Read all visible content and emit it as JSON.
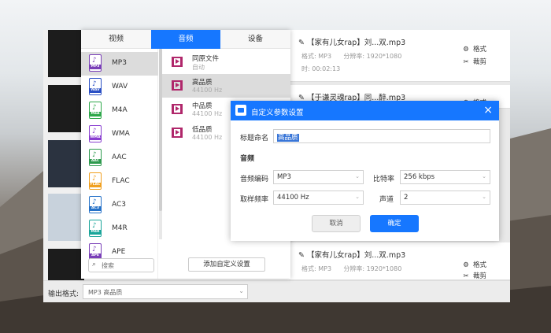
{
  "tabs": [
    {
      "label": "视频"
    },
    {
      "label": "音频"
    },
    {
      "label": "设备"
    }
  ],
  "formats": [
    {
      "label": "MP3",
      "tag": "MP3",
      "color": "#7a3fb8"
    },
    {
      "label": "WAV",
      "tag": "WAV",
      "color": "#2a4fc4"
    },
    {
      "label": "M4A",
      "tag": "M4A",
      "color": "#2ea84a"
    },
    {
      "label": "WMA",
      "tag": "WMA",
      "color": "#8a3fd0"
    },
    {
      "label": "AAC",
      "tag": "AAC",
      "color": "#2e9a4e"
    },
    {
      "label": "FLAC",
      "tag": "FLAC",
      "color": "#f0a020"
    },
    {
      "label": "AC3",
      "tag": "AC3",
      "color": "#2672c8"
    },
    {
      "label": "M4R",
      "tag": "M4R",
      "color": "#1aa59a"
    },
    {
      "label": "APE",
      "tag": "APE",
      "color": "#7a3fb8"
    }
  ],
  "search": {
    "placeholder": "搜索"
  },
  "qualities": [
    {
      "name": "同原文件",
      "sub": "自动"
    },
    {
      "name": "高品质",
      "sub": "44100 Hz"
    },
    {
      "name": "中品质",
      "sub": "44100 Hz"
    },
    {
      "name": "低品质",
      "sub": "44100 Hz"
    }
  ],
  "add_custom_label": "添加自定义设置",
  "files": [
    {
      "name": "【家有儿女rap】刘...双.mp3",
      "format": "格式: MP3",
      "resolution": "分辨率: 1920*1080",
      "duration": "时: 00:02:13",
      "act1": "格式",
      "act2": "裁剪"
    },
    {
      "name": "【于谦灵魂rap】同...醉.mp3",
      "act1": "格式"
    },
    {
      "name": "【家有儿女rap】刘...双.mp3",
      "format": "格式: MP3",
      "resolution": "分辨率: 1920*1080",
      "act1": "格式",
      "act2": "裁剪"
    }
  ],
  "output": {
    "label": "输出格式:",
    "value": "MP3  高品质"
  },
  "dialog": {
    "title": "自定义参数设置",
    "close": "×",
    "name_label": "标题命名",
    "name_value": "高品质",
    "section": "音频",
    "codec_label": "音频编码",
    "codec_value": "MP3",
    "bitrate_label": "比特率",
    "bitrate_value": "256 kbps",
    "samplerate_label": "取样频率",
    "samplerate_value": "44100 Hz",
    "channel_label": "声道",
    "channel_value": "2",
    "cancel": "取消",
    "ok": "确定"
  },
  "colors": {
    "accent": "#1677ff",
    "quality_icon": "#b0276b"
  }
}
